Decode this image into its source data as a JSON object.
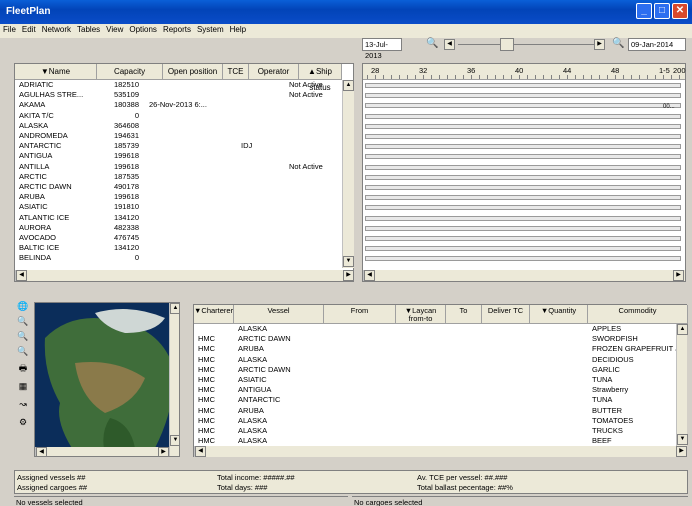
{
  "window": {
    "title": "FleetPlan"
  },
  "menu": [
    "File",
    "Edit",
    "Network",
    "Tables",
    "View",
    "Options",
    "Reports",
    "System",
    "Help"
  ],
  "timeline": {
    "start_date": "13-Jul-2013",
    "end_date": "09-Jan-2014",
    "week_labels": [
      "28",
      "32",
      "36",
      "40",
      "44",
      "48",
      "1-5"
    ],
    "end_label": "200",
    "bar_label": "00..."
  },
  "vessel_table": {
    "columns": [
      "▼Name",
      "Capacity",
      "Open position",
      "TCE",
      "Operator",
      "▲Ship status"
    ],
    "rows": [
      [
        "ADRIATIC",
        "182510",
        "",
        "",
        "",
        "Not Active"
      ],
      [
        "AGULHAS STRE...",
        "535109",
        "",
        "",
        "",
        "Not Active"
      ],
      [
        "AKAMA",
        "180388",
        "26-Nov-2013 6:...",
        "",
        "",
        ""
      ],
      [
        "AKITA T/C",
        "0",
        "",
        "",
        "",
        ""
      ],
      [
        "ALASKA",
        "364608",
        "",
        "",
        "",
        ""
      ],
      [
        "ANDROMEDA",
        "194631",
        "",
        "",
        "",
        ""
      ],
      [
        "ANTARCTIC",
        "185739",
        "",
        "",
        "IDJ",
        ""
      ],
      [
        "ANTIGUA",
        "199618",
        "",
        "",
        "",
        ""
      ],
      [
        "ANTILLA",
        "199618",
        "",
        "",
        "",
        "Not Active"
      ],
      [
        "ARCTIC",
        "187535",
        "",
        "",
        "",
        ""
      ],
      [
        "ARCTIC DAWN",
        "490178",
        "",
        "",
        "",
        ""
      ],
      [
        "ARUBA",
        "199618",
        "",
        "",
        "",
        ""
      ],
      [
        "ASIATIC",
        "191810",
        "",
        "",
        "",
        ""
      ],
      [
        "ATLANTIC ICE",
        "134120",
        "",
        "",
        "",
        ""
      ],
      [
        "AURORA",
        "482338",
        "",
        "",
        "",
        ""
      ],
      [
        "AVOCADO",
        "476745",
        "",
        "",
        "",
        ""
      ],
      [
        "BALTIC ICE",
        "134120",
        "",
        "",
        "",
        ""
      ],
      [
        "BELINDA",
        "0",
        "",
        "",
        "",
        ""
      ]
    ]
  },
  "cargo_table": {
    "columns": [
      "▼Charterer",
      "Vessel",
      "From",
      "▼Laycan from-to",
      "To",
      "Deliver TC",
      "▼Quantity",
      "Commodity"
    ],
    "rows": [
      [
        "",
        "ALASKA",
        "",
        "",
        "",
        "",
        "",
        "APPLES"
      ],
      [
        "HMC",
        "ARCTIC DAWN",
        "",
        "",
        "",
        "",
        "",
        "SWORDFISH"
      ],
      [
        "HMC",
        "ARUBA",
        "",
        "",
        "",
        "",
        "",
        "FROZEN GRAPEFRUIT J..."
      ],
      [
        "HMC",
        "ALASKA",
        "",
        "",
        "",
        "",
        "",
        "DECIDIOUS"
      ],
      [
        "HMC",
        "ARCTIC DAWN",
        "",
        "",
        "",
        "",
        "",
        "GARLIC"
      ],
      [
        "HMC",
        "ASIATIC",
        "",
        "",
        "",
        "",
        "",
        "TUNA"
      ],
      [
        "HMC",
        "ANTIGUA",
        "",
        "",
        "",
        "",
        "",
        "Strawberry"
      ],
      [
        "HMC",
        "ANTARCTIC",
        "",
        "",
        "",
        "",
        "",
        "TUNA"
      ],
      [
        "HMC",
        "ARUBA",
        "",
        "",
        "",
        "",
        "",
        "BUTTER"
      ],
      [
        "HMC",
        "ALASKA",
        "",
        "",
        "",
        "",
        "",
        "TOMATOES"
      ],
      [
        "HMC",
        "ALASKA",
        "",
        "",
        "",
        "",
        "",
        "TRUCKS"
      ],
      [
        "HMC",
        "ALASKA",
        "",
        "",
        "",
        "",
        "",
        "BEEF"
      ]
    ]
  },
  "stats": {
    "assigned_vessels": "Assigned vessels ##",
    "assigned_cargoes": "Assigned cargoes ##",
    "total_income": "Total income: #####.##",
    "total_days": "Total days: ###",
    "avg_tce": "Av. TCE per vessel: ##.###",
    "ballast": "Total ballast pecentage: ##%"
  },
  "status": {
    "left": "No vessels selected",
    "right": "No cargoes selected"
  }
}
